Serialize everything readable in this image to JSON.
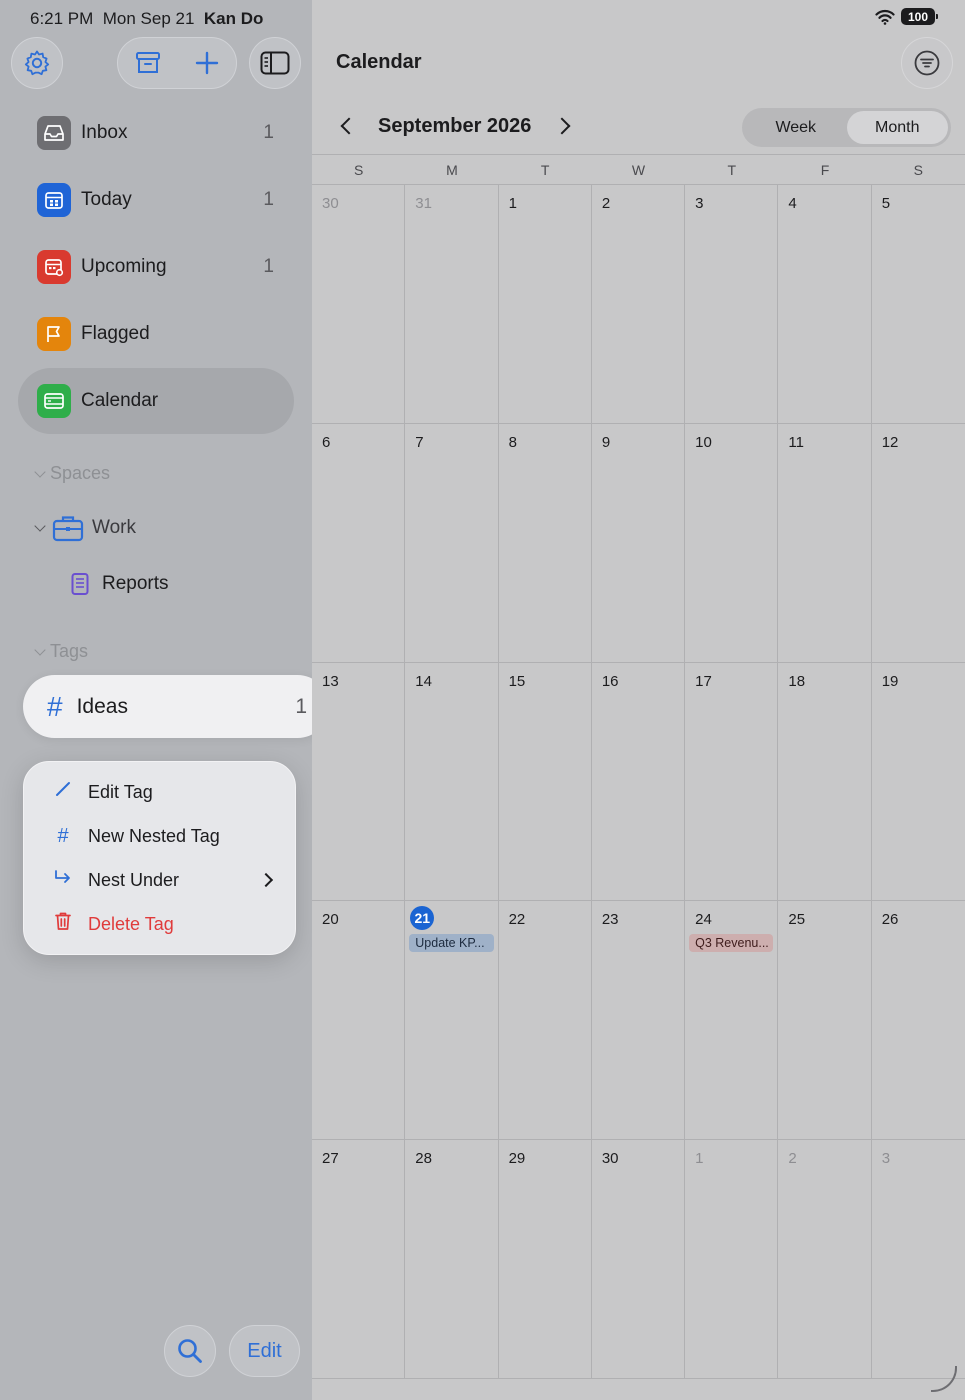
{
  "status": {
    "time": "6:21 PM",
    "date": "Mon Sep 21",
    "user": "Kan Do",
    "battery": "100"
  },
  "toolbar": {
    "settings_icon": "gear-icon",
    "archive_icon": "archive-icon",
    "add_icon": "plus-icon",
    "sidebar_icon": "sidebar-toggle-icon"
  },
  "sidebar": {
    "items": [
      {
        "label": "Inbox",
        "count": "1",
        "icon": "inbox-icon",
        "color": "#6e6e72"
      },
      {
        "label": "Today",
        "count": "1",
        "icon": "calendar-today-icon",
        "color": "#1f64d6"
      },
      {
        "label": "Upcoming",
        "count": "1",
        "icon": "calendar-upcoming-icon",
        "color": "#d93a2f"
      },
      {
        "label": "Flagged",
        "count": "",
        "icon": "flag-icon",
        "color": "#e4850c"
      },
      {
        "label": "Calendar",
        "count": "",
        "icon": "calendar-icon",
        "color": "#2fae4a"
      }
    ],
    "spaces_header": "Spaces",
    "work_label": "Work",
    "reports_label": "Reports",
    "tags_header": "Tags",
    "tag": {
      "label": "Ideas",
      "count": "1",
      "hash": "#"
    }
  },
  "context_menu": {
    "items": [
      {
        "label": "Edit Tag",
        "icon": "pencil-icon"
      },
      {
        "label": "New Nested Tag",
        "icon": "hash-icon"
      },
      {
        "label": "Nest Under",
        "icon": "nest-arrow-icon"
      },
      {
        "label": "Delete Tag",
        "icon": "trash-icon"
      }
    ]
  },
  "main": {
    "title": "Calendar",
    "month": "September 2026",
    "view_week": "Week",
    "view_month": "Month",
    "active_view": "Month"
  },
  "calendar": {
    "weekdays": [
      "S",
      "M",
      "T",
      "W",
      "T",
      "F",
      "S"
    ],
    "weeks": [
      [
        "30",
        "31",
        "1",
        "2",
        "3",
        "4",
        "5"
      ],
      [
        "6",
        "7",
        "8",
        "9",
        "10",
        "11",
        "12"
      ],
      [
        "13",
        "14",
        "15",
        "16",
        "17",
        "18",
        "19"
      ],
      [
        "20",
        "21",
        "22",
        "23",
        "24",
        "25",
        "26"
      ],
      [
        "27",
        "28",
        "29",
        "30",
        "1",
        "2",
        "3"
      ]
    ],
    "today": "21",
    "events": [
      {
        "day": "21",
        "title": "Update KP...",
        "color": "blue"
      },
      {
        "day": "24",
        "title": "Q3 Revenu...",
        "color": "red"
      }
    ]
  },
  "bottom": {
    "search_icon": "search-icon",
    "edit_label": "Edit"
  }
}
